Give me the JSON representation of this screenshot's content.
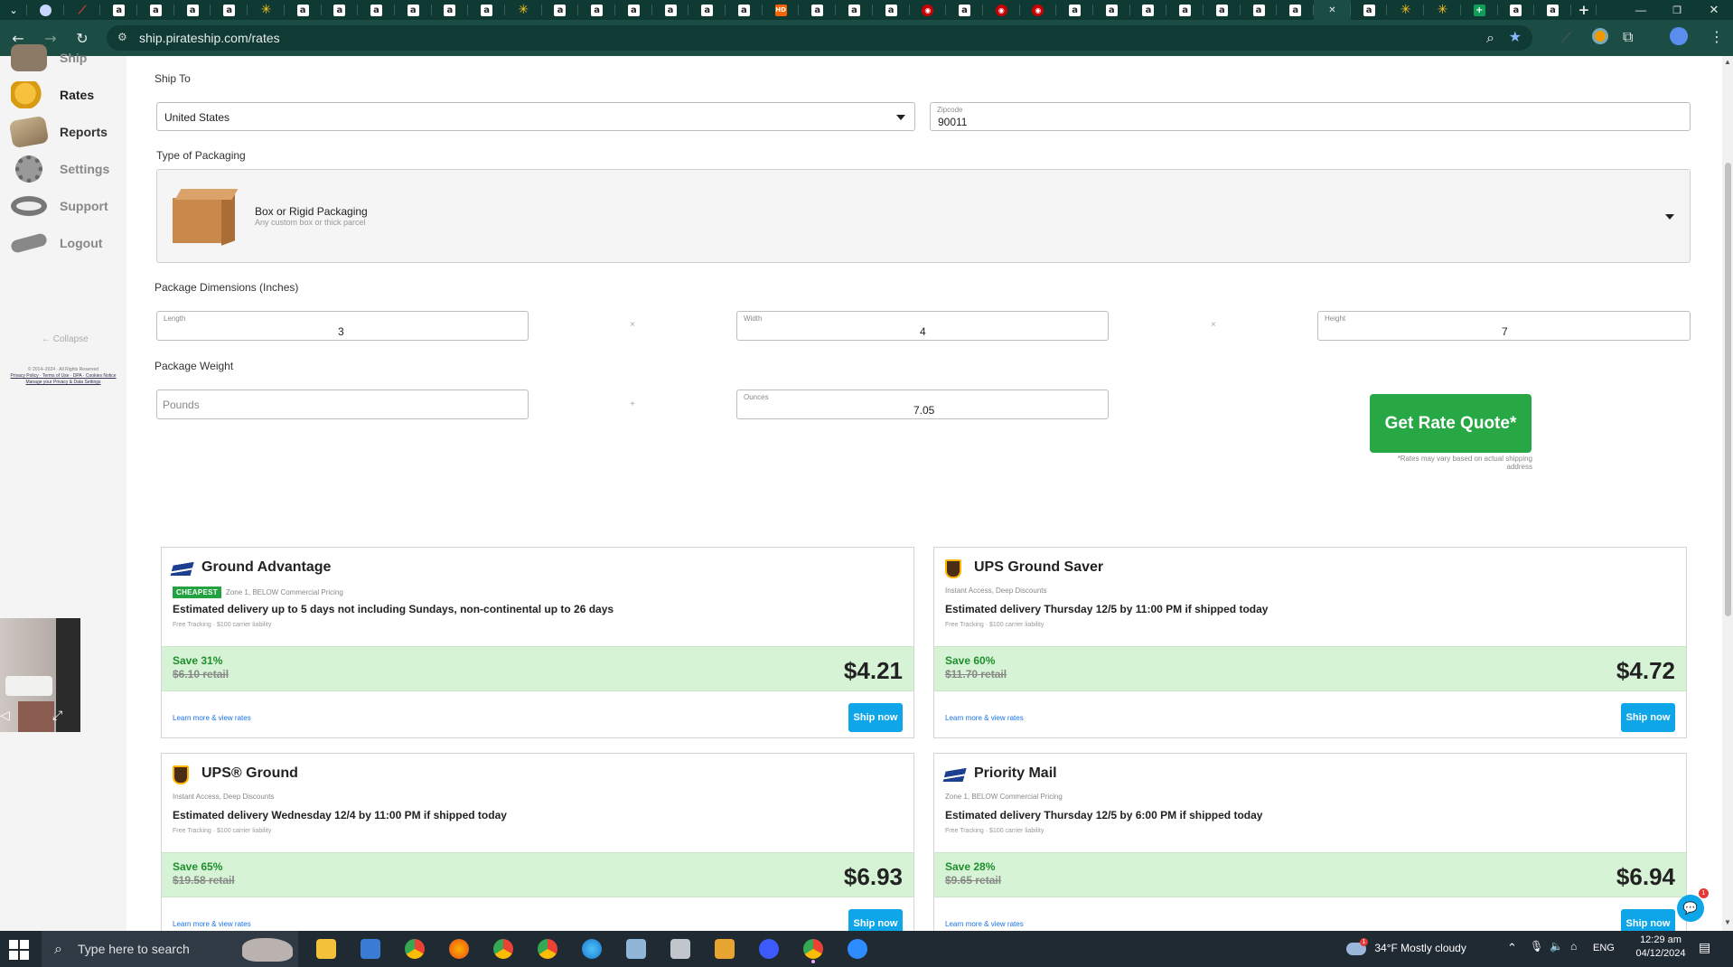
{
  "browser": {
    "url": "ship.pirateship.com/rates",
    "tabs": [
      {
        "icon": "gen-icon"
      },
      {
        "icon": "pen-icon"
      },
      {
        "icon": "amazon-icon"
      },
      {
        "icon": "amazon-icon"
      },
      {
        "icon": "amazon-icon"
      },
      {
        "icon": "amazon-icon"
      },
      {
        "icon": "walmart-icon"
      },
      {
        "icon": "amazon-icon"
      },
      {
        "icon": "amazon-icon"
      },
      {
        "icon": "amazon-icon"
      },
      {
        "icon": "amazon-icon"
      },
      {
        "icon": "amazon-icon"
      },
      {
        "icon": "amazon-icon"
      },
      {
        "icon": "walmart-icon"
      },
      {
        "icon": "amazon-icon"
      },
      {
        "icon": "amazon-icon"
      },
      {
        "icon": "amazon-icon"
      },
      {
        "icon": "amazon-icon"
      },
      {
        "icon": "amazon-icon"
      },
      {
        "icon": "amazon-icon"
      },
      {
        "icon": "homedepot-icon"
      },
      {
        "icon": "amazon-icon"
      },
      {
        "icon": "amazon-icon"
      },
      {
        "icon": "amazon-icon"
      },
      {
        "icon": "target-icon"
      },
      {
        "icon": "amazon-icon"
      },
      {
        "icon": "target-icon"
      },
      {
        "icon": "target-icon"
      },
      {
        "icon": "amazon-icon"
      },
      {
        "icon": "amazon-icon"
      },
      {
        "icon": "amazon-icon"
      },
      {
        "icon": "amazon-icon"
      },
      {
        "icon": "amazon-icon"
      },
      {
        "icon": "amazon-icon"
      },
      {
        "icon": "amazon-icon"
      },
      {
        "icon": "close-icon",
        "active": true
      },
      {
        "icon": "amazon-icon"
      },
      {
        "icon": "walmart-icon"
      },
      {
        "icon": "walmart-icon"
      },
      {
        "icon": "sheets-icon"
      },
      {
        "icon": "amazon-icon"
      },
      {
        "icon": "amazon-icon"
      }
    ]
  },
  "sidebar": {
    "items": [
      {
        "label": "Ship",
        "icon": "ship-icon"
      },
      {
        "label": "Rates",
        "icon": "coins-icon"
      },
      {
        "label": "Reports",
        "icon": "map-icon"
      },
      {
        "label": "Settings",
        "icon": "wheel-icon"
      },
      {
        "label": "Support",
        "icon": "lifebuoy-icon"
      },
      {
        "label": "Logout",
        "icon": "plank-icon"
      }
    ],
    "collapse_label": "← Collapse",
    "legal": [
      "© 2014–2024 · All Rights Reserved",
      "Privacy Policy · Terms of Use · DPA · Cookies Notice",
      "Manage your Privacy & Data Settings"
    ]
  },
  "form": {
    "ship_to_label": "Ship To",
    "country": "United States",
    "zipcode_label": "Zipcode",
    "zipcode": "90011",
    "packaging_label": "Type of Packaging",
    "packaging_title": "Box or Rigid Packaging",
    "packaging_desc": "Any custom box or thick parcel",
    "dims_label": "Package Dimensions (Inches)",
    "length_label": "Length",
    "length": "3",
    "width_label": "Width",
    "width": "4",
    "height_label": "Height",
    "height": "7",
    "times": "×",
    "weight_label": "Package Weight",
    "pounds_placeholder": "Pounds",
    "plus": "+",
    "ounces_label": "Ounces",
    "ounces": "7.05",
    "quote_button": "Get Rate Quote*",
    "quote_note": "*Rates may vary based on actual shipping address"
  },
  "rates": [
    {
      "carrier": "usps",
      "name": "Ground Advantage",
      "badge": "CHEAPEST",
      "sub": "Zone 1, BELOW Commercial Pricing",
      "est": "Estimated delivery up to 5 days not including Sundays, non-continental up to 26 days",
      "tracking": "Free Tracking · $100 carrier liability",
      "save": "Save 31%",
      "retail": "$6.10 retail",
      "price": "$4.21",
      "learn": "Learn more & view rates",
      "ship": "Ship now"
    },
    {
      "carrier": "ups",
      "name": "UPS Ground Saver",
      "badge": "",
      "sub": "Instant Access, Deep Discounts",
      "est": "Estimated delivery Thursday 12/5 by 11:00 PM if shipped today",
      "tracking": "Free Tracking · $100 carrier liability",
      "save": "Save 60%",
      "retail": "$11.70 retail",
      "price": "$4.72",
      "learn": "Learn more & view rates",
      "ship": "Ship now"
    },
    {
      "carrier": "ups",
      "name": "UPS® Ground",
      "badge": "",
      "sub": "Instant Access, Deep Discounts",
      "est": "Estimated delivery Wednesday 12/4 by 11:00 PM if shipped today",
      "tracking": "Free Tracking · $100 carrier liability",
      "save": "Save 65%",
      "retail": "$19.58 retail",
      "price": "$6.93",
      "learn": "Learn more & view rates",
      "ship": "Ship now"
    },
    {
      "carrier": "usps",
      "name": "Priority Mail",
      "badge": "",
      "sub": "Zone 1, BELOW Commercial Pricing",
      "est": "Estimated delivery Thursday 12/5 by 6:00 PM if shipped today",
      "tracking": "Free Tracking · $100 carrier liability",
      "save": "Save 28%",
      "retail": "$9.65 retail",
      "price": "$6.94",
      "learn": "Learn more & view rates",
      "ship": "Ship now"
    }
  ],
  "chat_badge": "1",
  "taskbar": {
    "search_placeholder": "Type here to search",
    "weather": "34°F  Mostly cloudy",
    "weather_badge": "1",
    "lang": "ENG",
    "time": "12:29 am",
    "date": "04/12/2024"
  },
  "colors": {
    "brand_green": "#27a844",
    "ship_blue": "#0ea5e9",
    "save_band": "#d6f3d5",
    "chrome_bg": "#1c4d45"
  }
}
